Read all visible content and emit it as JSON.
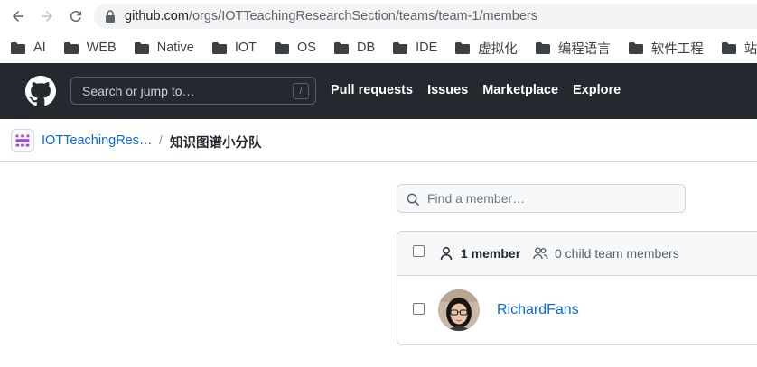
{
  "browser": {
    "url_host": "github.com",
    "url_path": "/orgs/IOTTeachingResearchSection/teams/team-1/members",
    "icons": [
      "back-arrow-icon",
      "forward-arrow-icon",
      "reload-icon",
      "lock-icon"
    ]
  },
  "bookmarks": [
    {
      "label": "AI"
    },
    {
      "label": "WEB"
    },
    {
      "label": "Native"
    },
    {
      "label": "IOT"
    },
    {
      "label": "OS"
    },
    {
      "label": "DB"
    },
    {
      "label": "IDE"
    },
    {
      "label": "虚拟化"
    },
    {
      "label": "编程语言"
    },
    {
      "label": "软件工程"
    },
    {
      "label": "站点"
    }
  ],
  "header": {
    "search_placeholder": "Search or jump to…",
    "search_shortcut": "/",
    "nav": [
      "Pull requests",
      "Issues",
      "Marketplace",
      "Explore"
    ],
    "colors": {
      "background": "#24292f",
      "text": "#ffffff"
    }
  },
  "breadcrumb": {
    "org": "IOTTeachingRes…",
    "separator": "/",
    "team": "知识图谱小分队"
  },
  "members": {
    "find_placeholder": "Find a member…",
    "member_count": "1 member",
    "child_team_members": "0 child team members",
    "list": [
      {
        "name": "RichardFans"
      }
    ]
  },
  "colors": {
    "link": "#0969da",
    "border": "#d0d7de",
    "muted": "#57606a"
  }
}
